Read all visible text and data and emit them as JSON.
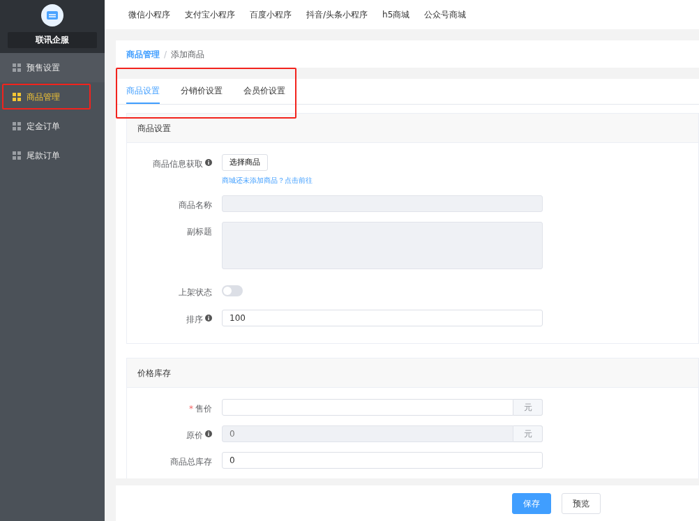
{
  "sidebar": {
    "brand": "联讯企服",
    "items": [
      {
        "label": "预售设置",
        "selected": false,
        "highlighted": false
      },
      {
        "label": "商品管理",
        "selected": true,
        "highlighted": true
      },
      {
        "label": "定金订单",
        "selected": false,
        "highlighted": false
      },
      {
        "label": "尾款订单",
        "selected": false,
        "highlighted": false
      }
    ]
  },
  "top_nav": [
    "微信小程序",
    "支付宝小程序",
    "百度小程序",
    "抖音/头条小程序",
    "h5商城",
    "公众号商城"
  ],
  "breadcrumb": [
    "商品管理",
    "添加商品"
  ],
  "breadcrumb_separator": "/",
  "required_symbol": "*",
  "tabs_highlighted": true,
  "tabs": [
    {
      "label": "商品设置",
      "selected": true
    },
    {
      "label": "分销价设置",
      "selected": false
    },
    {
      "label": "会员价设置",
      "selected": false
    }
  ],
  "sections": [
    {
      "title": "商品设置",
      "fields": [
        {
          "kind": "button",
          "label": "商品信息获取",
          "info": true,
          "required": false,
          "button": "选择商品",
          "hint": "商城还未添加商品？点击前往"
        },
        {
          "kind": "text",
          "label": "商品名称",
          "info": false,
          "required": false,
          "disabled": true
        },
        {
          "kind": "textarea",
          "label": "副标题",
          "info": false,
          "required": false,
          "disabled": true
        },
        {
          "kind": "switch",
          "label": "上架状态",
          "info": false,
          "required": false,
          "on": false
        },
        {
          "kind": "text",
          "label": "排序",
          "info": true,
          "required": false,
          "disabled": false,
          "value": "100"
        }
      ]
    },
    {
      "title": "价格库存",
      "fields": [
        {
          "kind": "text",
          "label": "售价",
          "info": false,
          "required": true,
          "disabled": false,
          "suffix": "元"
        },
        {
          "kind": "text",
          "label": "原价",
          "info": true,
          "required": false,
          "disabled": true,
          "placeholder": "0",
          "suffix": "元"
        },
        {
          "kind": "text",
          "label": "商品总库存",
          "info": false,
          "required": false,
          "disabled": false,
          "value": "0"
        }
      ]
    }
  ],
  "footer_buttons": [
    {
      "label": "保存",
      "kind": "primary"
    },
    {
      "label": "预览",
      "kind": "default"
    }
  ]
}
